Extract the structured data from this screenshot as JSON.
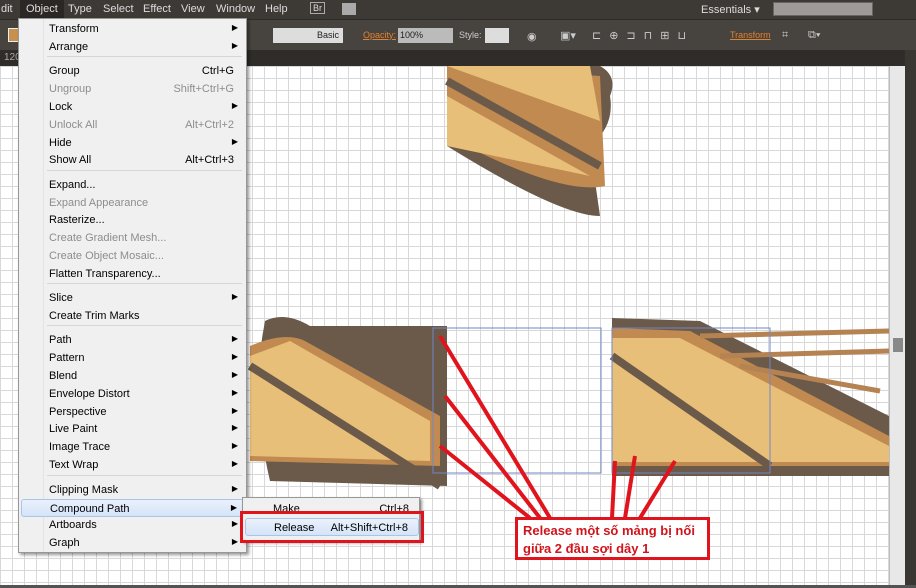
{
  "menubar": {
    "items": [
      "dit",
      "Object",
      "Type",
      "Select",
      "Effect",
      "View",
      "Window",
      "Help"
    ],
    "bridge": "Br",
    "workspace": "Essentials"
  },
  "controlbar": {
    "stroke_style": "Basic",
    "opacity_label": "Opacity:",
    "opacity_value": "100%",
    "style_label": "Style:",
    "transform_label": "Transform"
  },
  "tab": {
    "zoom": "120"
  },
  "object_menu": {
    "items": [
      {
        "label": "Transform",
        "submenu": true
      },
      {
        "label": "Arrange",
        "submenu": true
      },
      {
        "label": "Group",
        "shortcut": "Ctrl+G"
      },
      {
        "label": "Ungroup",
        "shortcut": "Shift+Ctrl+G",
        "disabled": true
      },
      {
        "label": "Lock",
        "submenu": true
      },
      {
        "label": "Unlock All",
        "shortcut": "Alt+Ctrl+2",
        "disabled": true
      },
      {
        "label": "Hide",
        "submenu": true
      },
      {
        "label": "Show All",
        "shortcut": "Alt+Ctrl+3"
      },
      {
        "label": "Expand..."
      },
      {
        "label": "Expand Appearance",
        "disabled": true
      },
      {
        "label": "Rasterize..."
      },
      {
        "label": "Create Gradient Mesh...",
        "disabled": true
      },
      {
        "label": "Create Object Mosaic...",
        "disabled": true
      },
      {
        "label": "Flatten Transparency..."
      },
      {
        "label": "Slice",
        "submenu": true
      },
      {
        "label": "Create Trim Marks"
      },
      {
        "label": "Path",
        "submenu": true
      },
      {
        "label": "Pattern",
        "submenu": true
      },
      {
        "label": "Blend",
        "submenu": true
      },
      {
        "label": "Envelope Distort",
        "submenu": true
      },
      {
        "label": "Perspective",
        "submenu": true
      },
      {
        "label": "Live Paint",
        "submenu": true
      },
      {
        "label": "Image Trace",
        "submenu": true
      },
      {
        "label": "Text Wrap",
        "submenu": true
      },
      {
        "label": "Clipping Mask",
        "submenu": true
      },
      {
        "label": "Compound Path",
        "submenu": true,
        "highlighted": true
      },
      {
        "label": "Artboards",
        "submenu": true
      },
      {
        "label": "Graph",
        "submenu": true
      }
    ]
  },
  "compound_submenu": {
    "items": [
      {
        "label": "Make",
        "shortcut": "Ctrl+8"
      },
      {
        "label": "Release",
        "shortcut": "Alt+Shift+Ctrl+8",
        "highlighted": true
      }
    ]
  },
  "annotation": {
    "line1": "Release một số mảng bị nối",
    "line2": "giữa 2 đầu sợi dây 1",
    "color": "#e0141c"
  },
  "colors": {
    "rope_outer": "#6b5a4a",
    "rope_mid": "#c08a50",
    "rope_fill": "#e8bf78"
  }
}
